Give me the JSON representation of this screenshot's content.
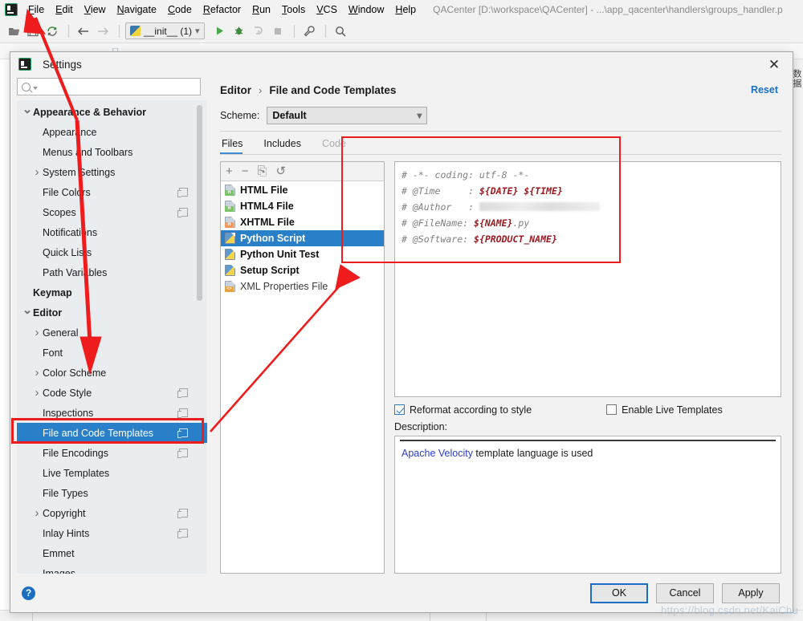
{
  "ide": {
    "menu_items": [
      "File",
      "Edit",
      "View",
      "Navigate",
      "Code",
      "Refactor",
      "Run",
      "Tools",
      "VCS",
      "Window",
      "Help"
    ],
    "window_title": "QACenter [D:\\workspace\\QACenter] - ...\\app_qacenter\\handlers\\groups_handler.p",
    "run_config": "__init__ (1)",
    "toolbar_icons": [
      "open-folder-icon",
      "save-icon",
      "sync-icon",
      "back-arrow-icon",
      "forward-arrow-icon",
      "run-icon",
      "debug-icon",
      "run-coverage-icon",
      "stop-icon",
      "wrench-icon",
      "search-icon"
    ]
  },
  "dialog": {
    "title": "Settings",
    "close_label": "✕",
    "search_placeholder": "",
    "search_value": "",
    "reset_label": "Reset",
    "breadcrumb": {
      "parent": "Editor",
      "separator": "›",
      "current": "File and Code Templates"
    },
    "scheme": {
      "label": "Scheme:",
      "value": "Default"
    },
    "tabs": [
      {
        "label": "Files",
        "state": "active"
      },
      {
        "label": "Includes",
        "state": "normal"
      },
      {
        "label": "Code",
        "state": "dim"
      }
    ],
    "tree": [
      {
        "label": "Appearance & Behavior",
        "indent": 0,
        "twisty": "down",
        "bold": true,
        "badge": false,
        "selected": false
      },
      {
        "label": "Appearance",
        "indent": 1,
        "twisty": "none",
        "bold": false,
        "badge": false,
        "selected": false
      },
      {
        "label": "Menus and Toolbars",
        "indent": 1,
        "twisty": "none",
        "bold": false,
        "badge": false,
        "selected": false
      },
      {
        "label": "System Settings",
        "indent": 1,
        "twisty": "right",
        "bold": false,
        "badge": false,
        "selected": false
      },
      {
        "label": "File Colors",
        "indent": 1,
        "twisty": "none",
        "bold": false,
        "badge": true,
        "selected": false
      },
      {
        "label": "Scopes",
        "indent": 1,
        "twisty": "none",
        "bold": false,
        "badge": true,
        "selected": false
      },
      {
        "label": "Notifications",
        "indent": 1,
        "twisty": "none",
        "bold": false,
        "badge": false,
        "selected": false
      },
      {
        "label": "Quick Lists",
        "indent": 1,
        "twisty": "none",
        "bold": false,
        "badge": false,
        "selected": false
      },
      {
        "label": "Path Variables",
        "indent": 1,
        "twisty": "none",
        "bold": false,
        "badge": false,
        "selected": false
      },
      {
        "label": "Keymap",
        "indent": 0,
        "twisty": "none",
        "bold": true,
        "badge": false,
        "selected": false
      },
      {
        "label": "Editor",
        "indent": 0,
        "twisty": "down",
        "bold": true,
        "badge": false,
        "selected": false
      },
      {
        "label": "General",
        "indent": 1,
        "twisty": "right",
        "bold": false,
        "badge": false,
        "selected": false
      },
      {
        "label": "Font",
        "indent": 1,
        "twisty": "none",
        "bold": false,
        "badge": false,
        "selected": false
      },
      {
        "label": "Color Scheme",
        "indent": 1,
        "twisty": "right",
        "bold": false,
        "badge": false,
        "selected": false
      },
      {
        "label": "Code Style",
        "indent": 1,
        "twisty": "right",
        "bold": false,
        "badge": true,
        "selected": false
      },
      {
        "label": "Inspections",
        "indent": 1,
        "twisty": "none",
        "bold": false,
        "badge": true,
        "selected": false
      },
      {
        "label": "File and Code Templates",
        "indent": 1,
        "twisty": "none",
        "bold": false,
        "badge": true,
        "selected": true
      },
      {
        "label": "File Encodings",
        "indent": 1,
        "twisty": "none",
        "bold": false,
        "badge": true,
        "selected": false
      },
      {
        "label": "Live Templates",
        "indent": 1,
        "twisty": "none",
        "bold": false,
        "badge": false,
        "selected": false
      },
      {
        "label": "File Types",
        "indent": 1,
        "twisty": "none",
        "bold": false,
        "badge": false,
        "selected": false
      },
      {
        "label": "Copyright",
        "indent": 1,
        "twisty": "right",
        "bold": false,
        "badge": true,
        "selected": false
      },
      {
        "label": "Inlay Hints",
        "indent": 1,
        "twisty": "none",
        "bold": false,
        "badge": true,
        "selected": false
      },
      {
        "label": "Emmet",
        "indent": 1,
        "twisty": "none",
        "bold": false,
        "badge": false,
        "selected": false
      },
      {
        "label": "Images",
        "indent": 1,
        "twisty": "none",
        "bold": false,
        "badge": false,
        "selected": false
      }
    ],
    "list_toolbar": [
      {
        "name": "add-template-button",
        "glyph": "+"
      },
      {
        "name": "remove-template-button",
        "glyph": "−"
      },
      {
        "name": "copy-template-button",
        "glyph": "⎘"
      },
      {
        "name": "reset-template-button",
        "glyph": "↺"
      }
    ],
    "templates": [
      {
        "label": "HTML File",
        "icon": "html-file-icon",
        "kind": "html",
        "selected": false,
        "bold": true
      },
      {
        "label": "HTML4 File",
        "icon": "html-file-icon",
        "kind": "html",
        "selected": false,
        "bold": true
      },
      {
        "label": "XHTML File",
        "icon": "xhtml-file-icon",
        "kind": "xhtml",
        "selected": false,
        "bold": true
      },
      {
        "label": "Python Script",
        "icon": "python-file-icon",
        "kind": "py",
        "selected": true,
        "bold": true
      },
      {
        "label": "Python Unit Test",
        "icon": "python-file-icon",
        "kind": "py",
        "selected": false,
        "bold": true
      },
      {
        "label": "Setup Script",
        "icon": "python-file-icon",
        "kind": "py",
        "selected": false,
        "bold": true
      },
      {
        "label": "XML Properties File",
        "icon": "xml-file-icon",
        "kind": "xml",
        "selected": false,
        "bold": false
      }
    ],
    "code_lines": [
      {
        "prefix": "# -*- coding: utf-8 -*-",
        "var": "",
        "suffix": ""
      },
      {
        "prefix": "# @Time     : ",
        "var": "${DATE} ${TIME}",
        "suffix": ""
      },
      {
        "prefix": "# @Author   : ",
        "var": "",
        "suffix": "",
        "redacted": true
      },
      {
        "prefix": "# @FileName: ",
        "var": "${NAME}",
        "suffix": ".py"
      },
      {
        "prefix": "# @Software: ",
        "var": "${PRODUCT_NAME}",
        "suffix": ""
      }
    ],
    "checkboxes": [
      {
        "label": "Reformat according to style",
        "checked": true
      },
      {
        "label": "Enable Live Templates",
        "checked": false
      }
    ],
    "description": {
      "label": "Description:",
      "link_text": "Apache Velocity",
      "rest_text": " template language is used"
    },
    "footer": {
      "help_glyph": "?",
      "buttons": [
        {
          "label": "OK",
          "primary": true
        },
        {
          "label": "Cancel",
          "primary": false
        },
        {
          "label": "Apply",
          "primary": false
        }
      ]
    }
  },
  "annotations": {
    "highlight_color": "#ee1c1c",
    "watermark": "https://blog.csdn.net/KaiChu"
  }
}
